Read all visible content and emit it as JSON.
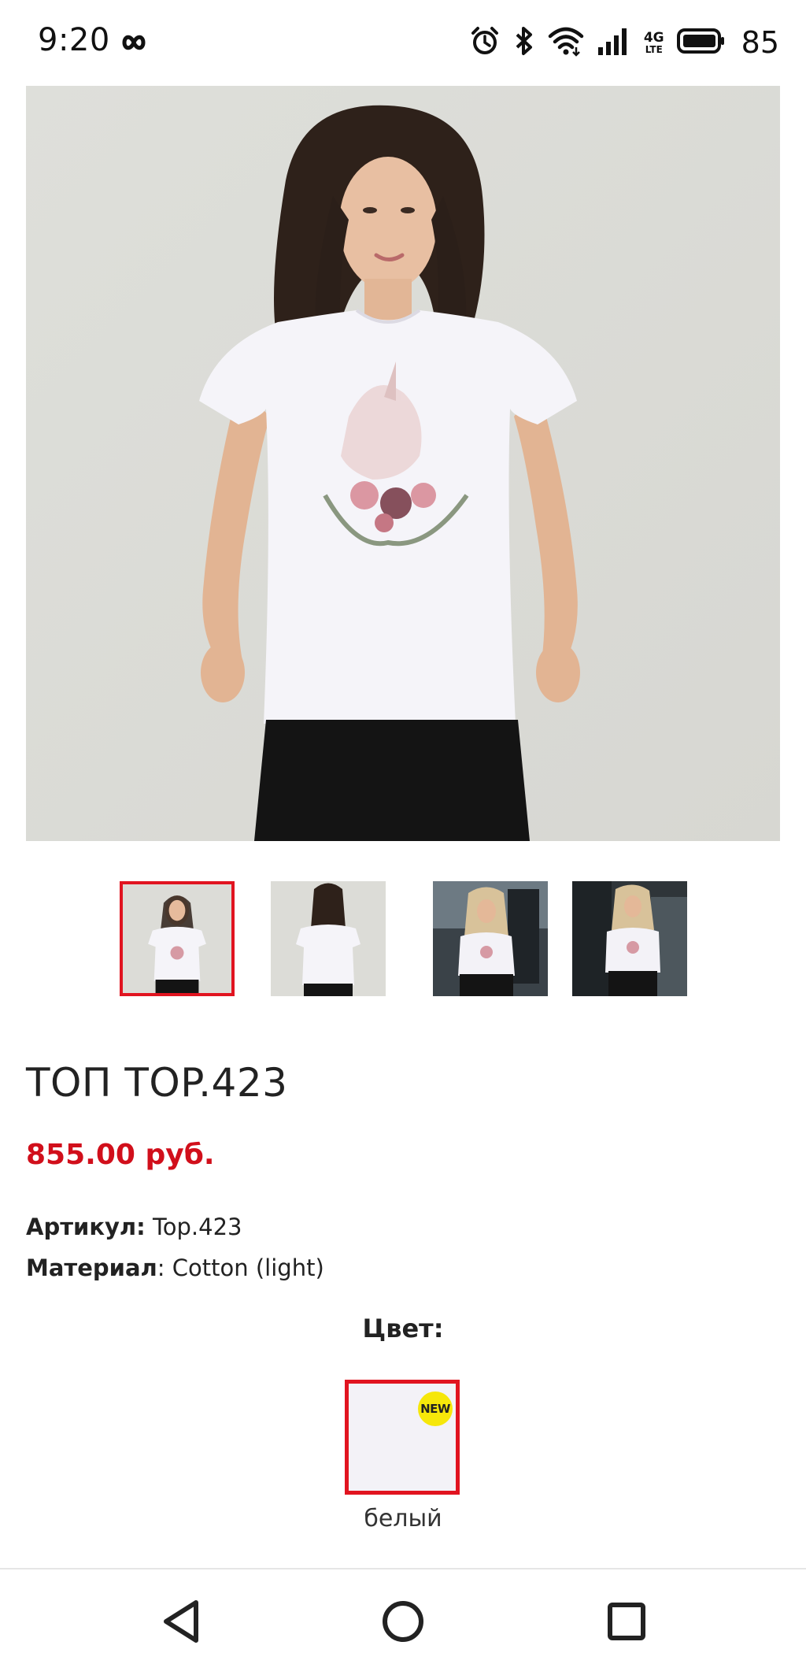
{
  "status_bar": {
    "time": "9:20",
    "infinity_icon": "infinity-icon",
    "alarm_icon": "alarm-icon",
    "bluetooth_icon": "bluetooth-icon",
    "wifi_icon": "wifi-icon",
    "signal_icon": "signal-icon",
    "network_top": "4G",
    "network_bottom": "LTE",
    "battery_icon": "battery-icon",
    "battery_level": "85"
  },
  "gallery": {
    "main_image_icon": "product-photo-front",
    "thumbnails": [
      {
        "icon": "thumbnail-front",
        "selected": true
      },
      {
        "icon": "thumbnail-back",
        "selected": false
      },
      {
        "icon": "thumbnail-lifestyle-1",
        "selected": false
      },
      {
        "icon": "thumbnail-lifestyle-2",
        "selected": false
      }
    ]
  },
  "product": {
    "title": "ТОП TOP.423",
    "price": "855.00 руб.",
    "sku_label": "Артикул:",
    "sku_value": "Top.423",
    "material_label": "Материал",
    "material_value": ": Cotton (light)",
    "color_heading": "Цвет:",
    "color_options": [
      {
        "label": "белый",
        "badge": "NEW",
        "selected": true,
        "swatch_color": "#f3f2f7"
      }
    ]
  },
  "nav_bar": {
    "back_icon": "back-triangle-icon",
    "home_icon": "home-circle-icon",
    "recents_icon": "recents-square-icon"
  },
  "colors": {
    "accent_red": "#e11420",
    "price_red": "#d10f1b",
    "badge_yellow": "#f6e70a"
  }
}
